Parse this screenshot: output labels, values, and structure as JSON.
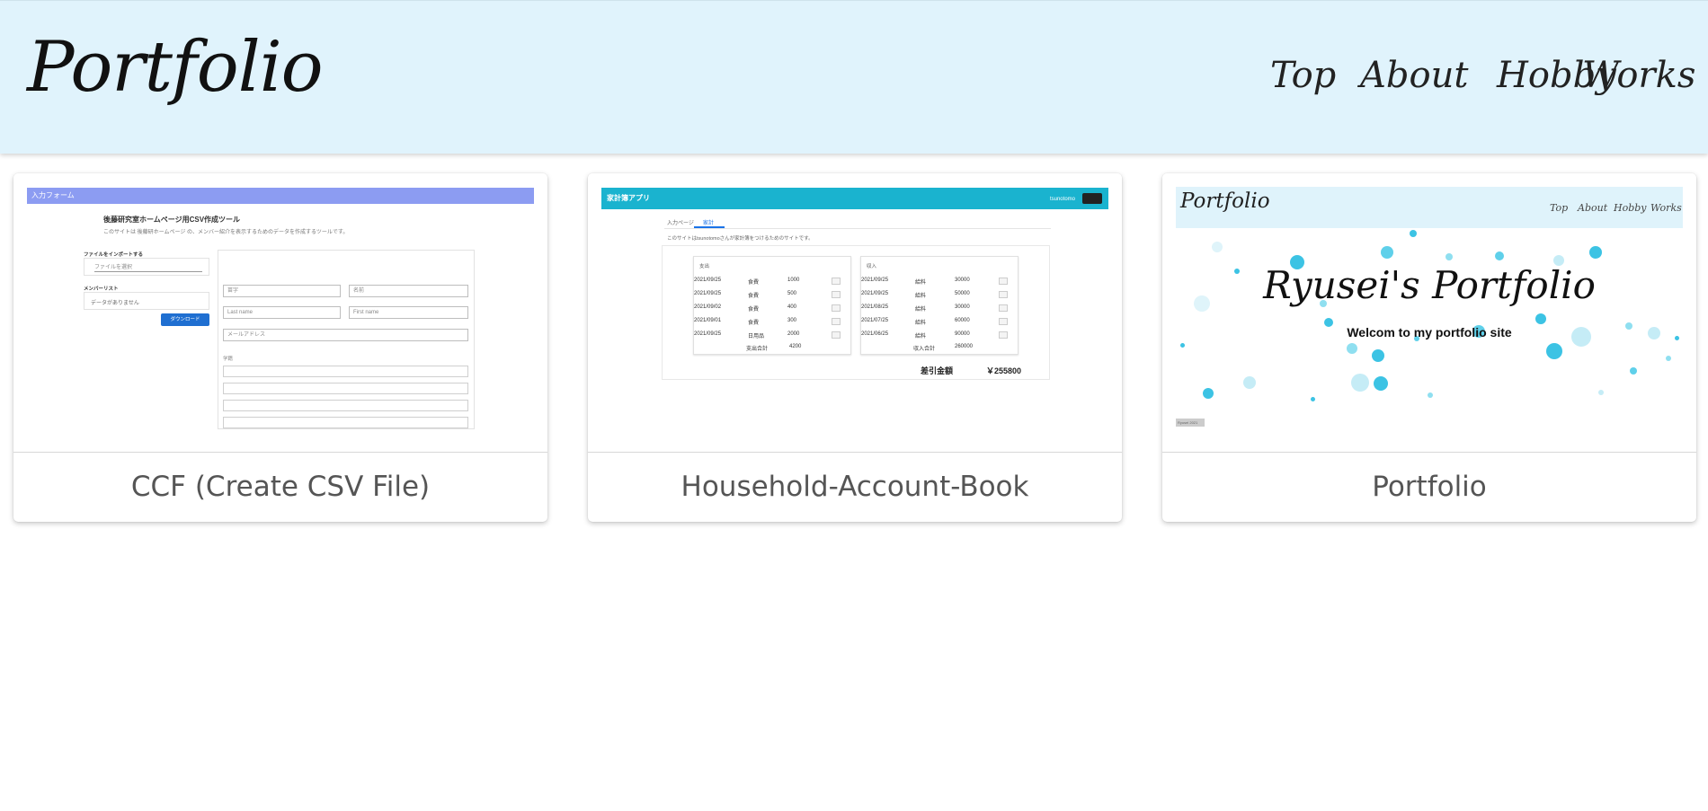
{
  "header": {
    "brand": "Portfolio",
    "nav": [
      "Top",
      "About",
      "Hobby",
      "Works"
    ]
  },
  "works": [
    {
      "caption": "CCF (Create CSV File)",
      "thumb": {
        "bar_title": "入力フォーム",
        "title": "後藤研究室ホームページ用CSV作成ツール",
        "subtitle": "このサイトは 後藤研ホームページ の、メンバー紹介を表示するためのデータを作成するツールです。",
        "import_label": "ファイルをインポートする",
        "file_placeholder": "ファイルを選択",
        "member_label": "メンバーリスト",
        "member_empty": "データがありません",
        "download": "ダウンロード",
        "fields": [
          "苗字",
          "名前",
          "Last name",
          "First name",
          "メールアドレス"
        ],
        "section_label": "学籍"
      }
    },
    {
      "caption": "Household-Account-Book",
      "thumb": {
        "app_title": "家計簿アプリ",
        "user": "tsunotomo",
        "tabs": [
          "入力ページ",
          "家計"
        ],
        "description": "このサイトはtsunotomoさんが家計簿をつけるためのサイトです。",
        "expense_header": "支出",
        "income_header": "収入",
        "expenses": [
          {
            "date": "2021/09/25",
            "category": "食費",
            "amount": "1000"
          },
          {
            "date": "2021/09/25",
            "category": "食費",
            "amount": "500"
          },
          {
            "date": "2021/09/02",
            "category": "食費",
            "amount": "400"
          },
          {
            "date": "2021/09/01",
            "category": "食費",
            "amount": "300"
          },
          {
            "date": "2021/09/25",
            "category": "日用品",
            "amount": "2000"
          }
        ],
        "incomes": [
          {
            "date": "2021/09/25",
            "category": "給料",
            "amount": "30000"
          },
          {
            "date": "2021/09/25",
            "category": "給料",
            "amount": "50000"
          },
          {
            "date": "2021/08/25",
            "category": "給料",
            "amount": "30000"
          },
          {
            "date": "2021/07/25",
            "category": "給料",
            "amount": "60000"
          },
          {
            "date": "2021/06/25",
            "category": "給料",
            "amount": "90000"
          }
        ],
        "expense_total_label": "支出合計",
        "expense_total": "4200",
        "income_total_label": "収入合計",
        "income_total": "260000",
        "diff_label": "差引金額",
        "diff_value": "￥255800"
      }
    },
    {
      "caption": "Portfolio",
      "thumb": {
        "brand": "Portfolio",
        "nav": [
          "Top",
          "About",
          "Hobby",
          "Works"
        ],
        "hero_title": "Ryusei's Portfolio",
        "welcome": "Welcom to my portfolio site",
        "footer": "Ryusei 2021"
      }
    }
  ]
}
